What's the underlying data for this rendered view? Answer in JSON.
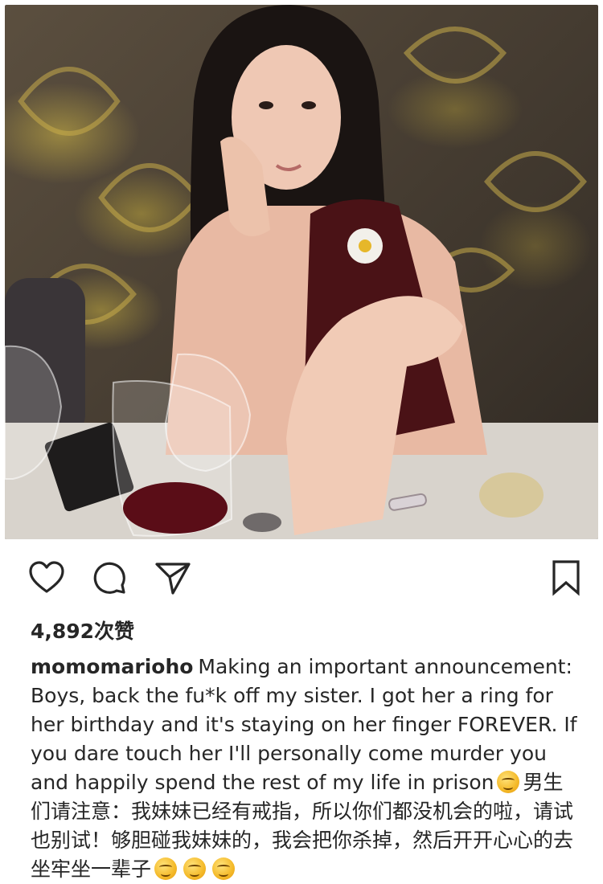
{
  "post": {
    "likes": "4,892次赞",
    "username": "momomarioho",
    "caption_en": "Making an important announcement: Boys, back the fu*k off my sister. I got her a ring for her birthday and it's staying on her finger FOREVER. If you dare touch her I'll personally come murder you and happily spend the rest of my life in prison",
    "caption_zh": "男生们请注意：我妹妹已经有戒指，所以你们都没机会的啦，请试也别试！够胆碰我妹妹的，我会把你杀掉，然后开开心心的去坐牢坐一辈子",
    "emoji_name": "upside-down-face-emoji"
  },
  "icons": {
    "like": "heart-icon",
    "comment": "comment-icon",
    "share": "send-icon",
    "save": "bookmark-icon"
  },
  "colors": {
    "text": "#262626",
    "background": "#ffffff"
  }
}
